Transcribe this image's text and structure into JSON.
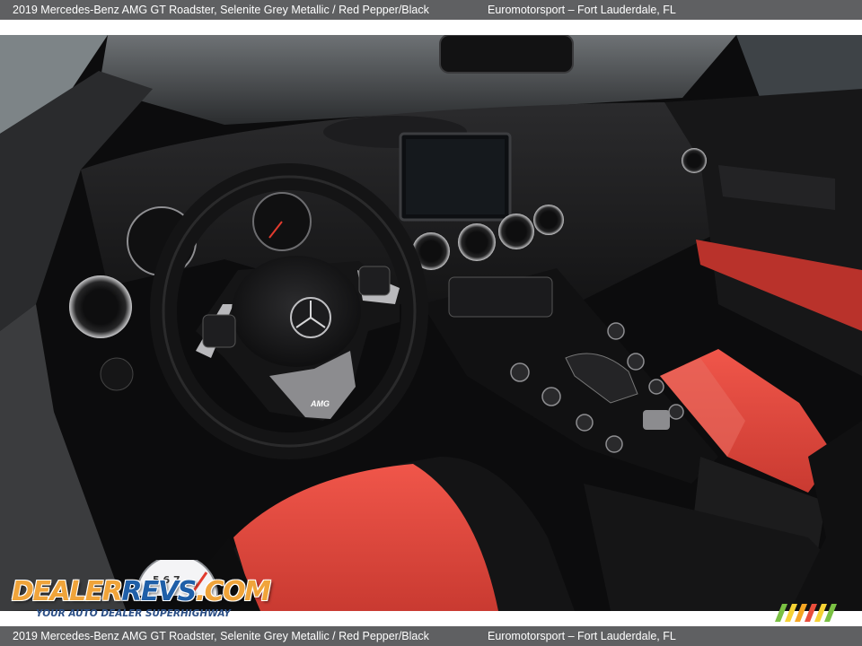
{
  "caption": {
    "title": "2019 Mercedes-Benz AMG GT Roadster,  Selenite Grey Metallic / Red Pepper/Black",
    "dealer": "Euromotorsport – Fort Lauderdale, FL"
  },
  "watermark": {
    "brand_part1": "DEALER",
    "brand_part2": "REVS",
    "brand_suffix": ".COM",
    "tagline": "YOUR AUTO DEALER SUPERHIGHWAY",
    "gauge_numbers": "5 6 7"
  },
  "photo": {
    "subject": "car interior",
    "steering_badge": "AMG"
  },
  "colors": {
    "caption_bar": "#5f6062",
    "seat_red": "#e0493e",
    "logo_orange": "#f0a43a",
    "logo_blue": "#1f5fa8",
    "stripes": [
      "#7ac143",
      "#f6d234",
      "#f5a623",
      "#e94e3b",
      "#f6d234",
      "#7ac143"
    ]
  }
}
